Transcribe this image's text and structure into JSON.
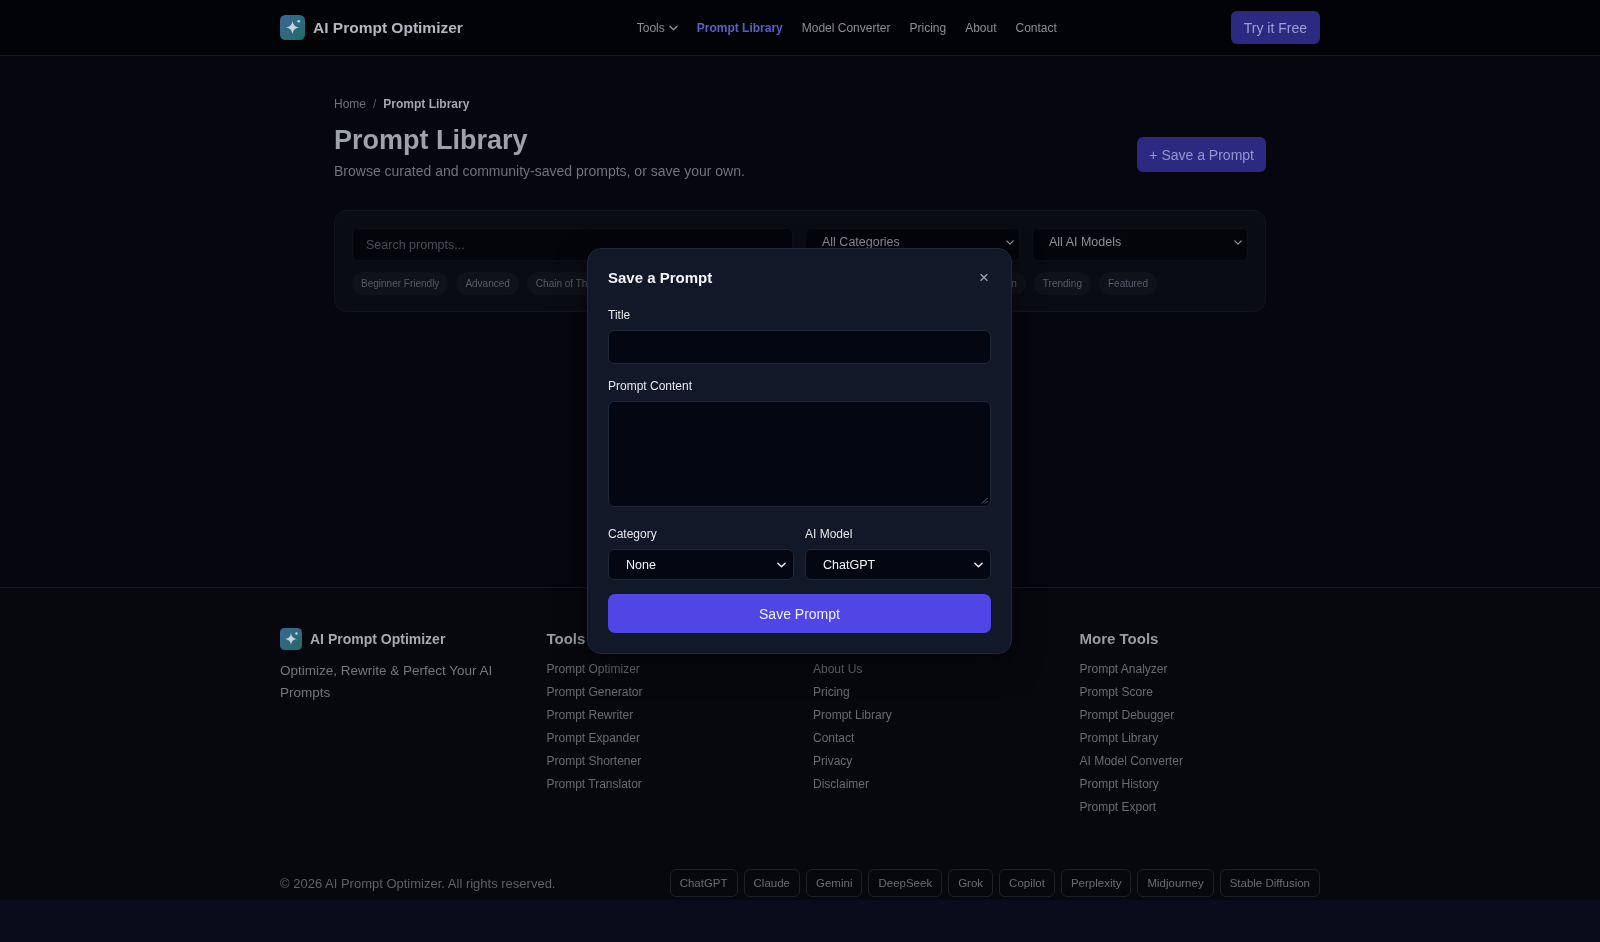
{
  "header": {
    "brand": "AI Prompt Optimizer",
    "nav": [
      {
        "label": "Tools",
        "kind": "dropdown",
        "selected": false
      },
      {
        "label": "Prompt Library",
        "kind": "link",
        "selected": true
      },
      {
        "label": "Model Converter",
        "kind": "link",
        "selected": false
      },
      {
        "label": "Pricing",
        "kind": "link",
        "selected": false
      },
      {
        "label": "About",
        "kind": "link",
        "selected": false
      },
      {
        "label": "Contact",
        "kind": "link",
        "selected": false
      }
    ],
    "cta": "Try it Free"
  },
  "breadcrumb": {
    "separator": "/",
    "items": [
      {
        "label": "Home",
        "current": false
      },
      {
        "label": "Prompt Library",
        "current": true
      }
    ]
  },
  "page": {
    "title": "Prompt Library",
    "subtitle": "Browse curated and community-saved prompts, or save your own.",
    "action": "+ Save a Prompt"
  },
  "filters": {
    "search": {
      "placeholder": "Search prompts..."
    },
    "selects": [
      {
        "value": "All Categories"
      },
      {
        "value": "All AI Models"
      }
    ],
    "tags": [
      {
        "label": "Beginner Friendly",
        "clipped_right": false,
        "clipped_left": false
      },
      {
        "label": "Advanced",
        "clipped_right": false,
        "clipped_left": false
      },
      {
        "label": "Chain of Th",
        "clipped_right": true,
        "clipped_left": false
      },
      {
        "label": "n",
        "clipped_right": false,
        "clipped_left": true
      },
      {
        "label": "Trending",
        "clipped_right": false,
        "clipped_left": false
      },
      {
        "label": "Featured",
        "clipped_right": false,
        "clipped_left": false
      }
    ]
  },
  "modal": {
    "title": "Save a Prompt",
    "close": "×",
    "fields": [
      {
        "label": "Title",
        "kind": "input"
      },
      {
        "label": "Prompt Content",
        "kind": "textarea"
      },
      {
        "label": "Category",
        "kind": "select",
        "value": "None"
      },
      {
        "label": "AI Model",
        "kind": "select",
        "value": "ChatGPT"
      }
    ],
    "submit": "Save Prompt"
  },
  "footer": {
    "brand": "AI Prompt Optimizer",
    "tagline": "Optimize, Rewrite & Perfect Your AI Prompts",
    "columns": [
      {
        "heading": "Tools",
        "links": [
          "Prompt Optimizer",
          "Prompt Generator",
          "Prompt Rewriter",
          "Prompt Expander",
          "Prompt Shortener",
          "Prompt Translator"
        ]
      },
      {
        "links": [
          "About Us",
          "Pricing",
          "Prompt Library",
          "Contact",
          "Privacy",
          "Disclaimer"
        ]
      },
      {
        "heading": "More Tools",
        "links": [
          "Prompt Analyzer",
          "Prompt Score",
          "Prompt Debugger",
          "Prompt Library",
          "AI Model Converter",
          "Prompt History",
          "Prompt Export"
        ]
      }
    ],
    "copyright": "© 2026 AI Prompt Optimizer. All rights reserved.",
    "models": [
      "ChatGPT",
      "Claude",
      "Gemini",
      "DeepSeek",
      "Grok",
      "Copilot",
      "Perplexity",
      "Midjourney",
      "Stable Diffusion"
    ]
  }
}
